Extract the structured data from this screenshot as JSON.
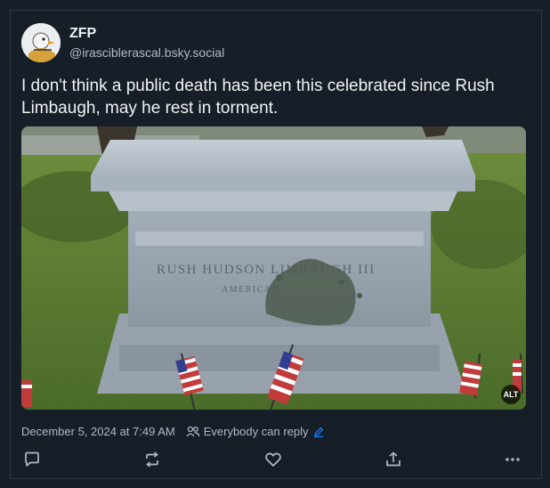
{
  "author": {
    "display_name": "ZFP",
    "handle": "@irasciblerascal.bsky.social",
    "avatar_icon": "duck-avatar"
  },
  "post": {
    "text": "I don't think a public death has been this celebrated since Rush Limbaugh, may he rest in torment.",
    "timestamp": "December 5, 2024 at 7:49 AM",
    "reply_setting": "Everybody can reply"
  },
  "media": {
    "engraving_line1": "RUSH HUDSON LIMBAUGH III",
    "engraving_line2": "AMERICAN",
    "alt_badge": "ALT"
  },
  "actions": {
    "reply_icon": "reply-icon",
    "repost_icon": "repost-icon",
    "like_icon": "heart-icon",
    "share_icon": "share-icon",
    "more_icon": "more-icon"
  },
  "colors": {
    "background": "#161e27",
    "text": "#f1f3f5",
    "muted": "#aebbc9",
    "accent": "#1083fe"
  }
}
